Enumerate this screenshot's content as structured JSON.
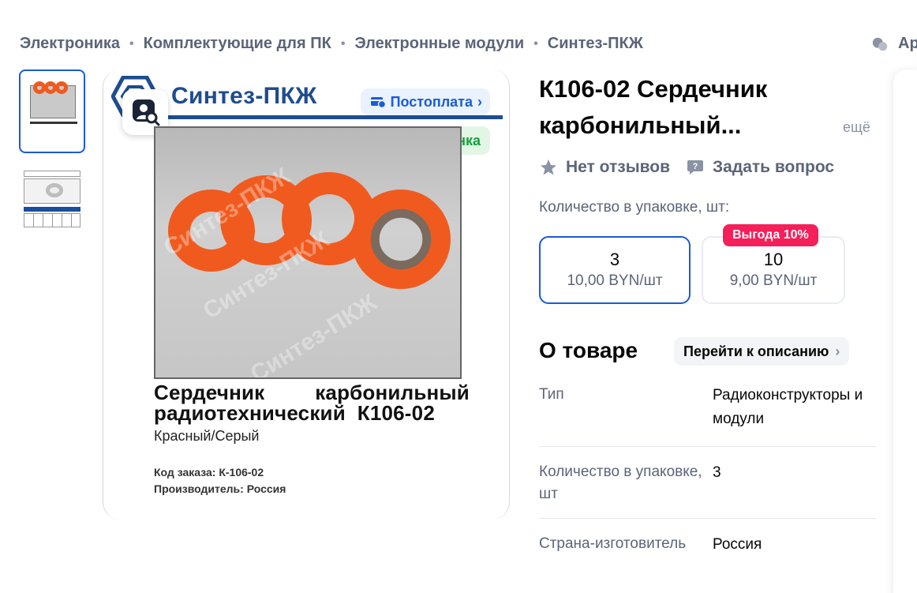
{
  "breadcrumbs": [
    "Электроника",
    "Комплектующие для ПК",
    "Электронные модули",
    "Синтез-ПКЖ"
  ],
  "header": {
    "right_label": "Ар"
  },
  "gallery": {
    "brand": "Синтез-ПКЖ",
    "postpay_label": "Постоплата",
    "new_label": "Новинка",
    "watermark": "Синтез-ПКЖ",
    "card_title_line1": [
      "Сердечник",
      "карбонильный"
    ],
    "card_title_line2": "радиотехнический  К106-02",
    "card_subtitle": "Красный/Серый",
    "card_meta": [
      "Код заказа: К-106-02",
      "Производитель: Россия"
    ],
    "thumbnails": [
      "thumb-1",
      "thumb-2"
    ]
  },
  "product": {
    "title": "К106-02 Сердечник карбонильный...",
    "more_label": "ещё",
    "reviews_label": "Нет отзывов",
    "question_label": "Задать вопрос",
    "quantity_label": "Количество в упаковке, шт:",
    "packs": [
      {
        "qty": "3",
        "price": "10,00 BYN/шт"
      },
      {
        "qty": "10",
        "price": "9,00 BYN/шт"
      }
    ],
    "benefit_badge": "Выгода 10%"
  },
  "about": {
    "title": "О товаре",
    "description_link": "Перейти к описанию",
    "specs": [
      {
        "key": "Тип",
        "value": "Радиоконструкторы и модули"
      },
      {
        "key": "Количество в упаковке, шт",
        "value": "3"
      },
      {
        "key": "Страна-изготовитель",
        "value": "Россия"
      }
    ]
  },
  "colors": {
    "accent": "#1a5bd8",
    "benefit": "#f51f5a",
    "new": "#12a23c",
    "brand": "#1e4d8f",
    "core": "#f15a1e"
  }
}
